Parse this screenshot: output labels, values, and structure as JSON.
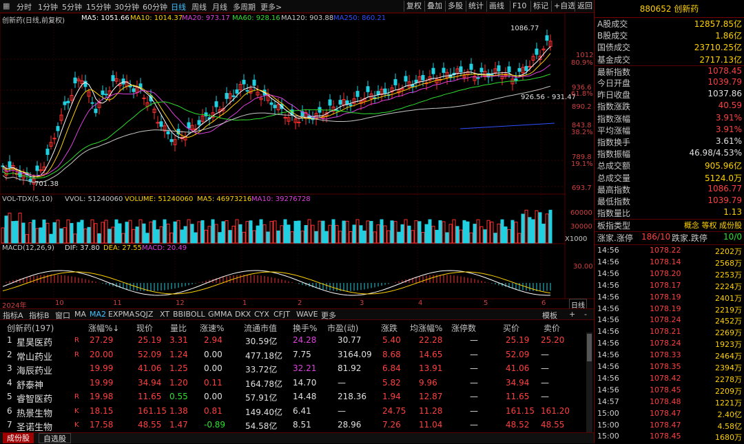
{
  "toolbar": {
    "periods": [
      "分时",
      "1分钟",
      "5分钟",
      "15分钟",
      "30分钟",
      "60分钟",
      "日线",
      "周线",
      "月线",
      "多周期",
      "更多>"
    ],
    "active_period": "日线",
    "right_buttons": [
      "复权",
      "叠加",
      "多股",
      "统计",
      "画线",
      "F10",
      "标记",
      "+自选",
      "返回"
    ]
  },
  "main": {
    "title": "创新药(日线,前复权)",
    "ma": [
      {
        "label": "MA5: 1051.66",
        "color": "#ffffff"
      },
      {
        "label": "MA10: 1014.37",
        "color": "#ffd200"
      },
      {
        "label": "MA20: 973.17",
        "color": "#e040e0"
      },
      {
        "label": "MA60: 928.16",
        "color": "#30e030"
      },
      {
        "label": "MA120: 903.88",
        "color": "#c8c8c8"
      },
      {
        "label": "MA250: 860.21",
        "color": "#3050ff"
      }
    ],
    "high_label": "1086.77",
    "low_label": "701.38",
    "mid_label": "926.56 - 931.47",
    "y_ticks": [
      {
        "price": "1012",
        "pct": "80.9%"
      },
      {
        "price": "936.6",
        "pct": "61.8%"
      },
      {
        "price": "890.2",
        "pct": ""
      },
      {
        "price": "843.8",
        "pct": "38.2%"
      },
      {
        "price": "789.8",
        "pct": "19.1%"
      },
      {
        "price": "693.7",
        "pct": ""
      }
    ]
  },
  "volume": {
    "title": "VOL-TDX(5,10)",
    "vol": "VVOL: 51240060",
    "volume": "VOLUME: 51240060",
    "ma5": "MA5: 46973216",
    "ma10": "MA10: 39276728",
    "y_ticks": [
      "60000",
      "30000"
    ],
    "unit": "X1000"
  },
  "macd": {
    "title": "MACD(12,26,9)",
    "dif": "DIF: 37.80",
    "dea": "DEA: 27.55",
    "macd": "MACD: 20.49",
    "y_tick": "30.00"
  },
  "x_axis": {
    "labels": [
      "2024年",
      "10",
      "11",
      "12",
      "1",
      "2",
      "3",
      "4",
      "5",
      "6"
    ],
    "period_box": "日线"
  },
  "tabs": [
    "指标A",
    "指标B",
    "窗口",
    "MA",
    "MA2",
    "EXPMA",
    "SQJZ",
    "XT",
    "BBIBOLL",
    "GMMA",
    "DKX",
    "CYX",
    "CFJT",
    "WAVE",
    "更多"
  ],
  "tabs_active": "MA2",
  "tabs_right": [
    "模板",
    "+",
    "-"
  ],
  "table": {
    "headers": [
      "创新药(197)",
      "涨幅%↓",
      "现价",
      "量比",
      "涨速%",
      "流通市值",
      "换手%",
      "市盈(动)",
      "涨跌",
      "均涨幅%",
      "涨停数",
      "买价",
      "卖价"
    ],
    "rows": [
      {
        "idx": "1",
        "name": "星昊医药",
        "flag": "R",
        "pct": "27.29",
        "price": "25.19",
        "lb": "3.31",
        "speed": "2.94",
        "cap": "30.59亿",
        "turn": "24.28",
        "pe": "30.77",
        "chg": "5.40",
        "avg": "22.28",
        "ztcount": "—",
        "buy": "25.19",
        "sell": "25.20"
      },
      {
        "idx": "2",
        "name": "常山药业",
        "flag": "R",
        "pct": "20.00",
        "price": "52.09",
        "lb": "1.24",
        "speed": "0.00",
        "cap": "477.18亿",
        "turn": "7.75",
        "pe": "3164.09",
        "chg": "8.68",
        "avg": "14.65",
        "ztcount": "—",
        "buy": "52.09",
        "sell": "—"
      },
      {
        "idx": "3",
        "name": "海辰药业",
        "flag": "",
        "pct": "19.99",
        "price": "41.06",
        "lb": "1.25",
        "speed": "0.00",
        "cap": "33.72亿",
        "turn": "32.21",
        "pe": "81.92",
        "chg": "6.84",
        "avg": "13.91",
        "ztcount": "—",
        "buy": "41.06",
        "sell": "—"
      },
      {
        "idx": "4",
        "name": "舒泰神",
        "flag": "",
        "pct": "19.99",
        "price": "34.94",
        "lb": "1.20",
        "speed": "0.11",
        "cap": "164.78亿",
        "turn": "14.70",
        "pe": "—",
        "chg": "5.82",
        "avg": "9.96",
        "ztcount": "—",
        "buy": "34.94",
        "sell": "—"
      },
      {
        "idx": "5",
        "name": "睿智医药",
        "flag": "R",
        "pct": "19.98",
        "price": "11.65",
        "lb": "0.55",
        "speed": "0.00",
        "cap": "57.91亿",
        "turn": "14.48",
        "pe": "218.36",
        "chg": "1.94",
        "avg": "12.87",
        "ztcount": "—",
        "buy": "11.65",
        "sell": "—"
      },
      {
        "idx": "6",
        "name": "热景生物",
        "flag": "K",
        "pct": "18.15",
        "price": "161.15",
        "lb": "1.38",
        "speed": "0.81",
        "cap": "149.40亿",
        "turn": "6.41",
        "pe": "—",
        "chg": "24.75",
        "avg": "11.28",
        "ztcount": "—",
        "buy": "161.15",
        "sell": "161.20"
      },
      {
        "idx": "7",
        "name": "圣诺生物",
        "flag": "K",
        "pct": "17.58",
        "price": "48.55",
        "lb": "1.47",
        "speed": "-0.89",
        "cap": "54.58亿",
        "turn": "8.51",
        "pe": "28.96",
        "chg": "7.26",
        "avg": "11.04",
        "ztcount": "—",
        "buy": "48.52",
        "sell": "48.55"
      }
    ]
  },
  "bottom_tabs": [
    "成份股",
    "自选股"
  ],
  "sidebar": {
    "header": "880652 创新药",
    "rows": [
      {
        "k": "A股成交",
        "v": "12857.85亿",
        "c": "#ffd200"
      },
      {
        "k": "B股成交",
        "v": "1.86亿",
        "c": "#ffd200"
      },
      {
        "k": "国债成交",
        "v": "23710.25亿",
        "c": "#ffd200"
      },
      {
        "k": "基金成交",
        "v": "2717.13亿",
        "c": "#ffd200"
      },
      {
        "k": "最新指数",
        "v": "1078.45",
        "c": "#ff4040"
      },
      {
        "k": "今日开盘",
        "v": "1039.79",
        "c": "#ff4040"
      },
      {
        "k": "昨日收盘",
        "v": "1037.86",
        "c": "#e0e0e0"
      },
      {
        "k": "指数涨跌",
        "v": "40.59",
        "c": "#ff4040"
      },
      {
        "k": "指数涨幅",
        "v": "3.91%",
        "c": "#ff4040"
      },
      {
        "k": "平均涨幅",
        "v": "3.91%",
        "c": "#ff4040"
      },
      {
        "k": "指数换手",
        "v": "3.61%",
        "c": "#e0e0e0"
      },
      {
        "k": "指数振幅",
        "v": "46.98/4.53%",
        "c": "#e0e0e0"
      },
      {
        "k": "总成交额",
        "v": "905.96亿",
        "c": "#ffd200"
      },
      {
        "k": "总成交量",
        "v": "5124.0万",
        "c": "#ffd200"
      },
      {
        "k": "最高指数",
        "v": "1086.77",
        "c": "#ff4040"
      },
      {
        "k": "最低指数",
        "v": "1039.79",
        "c": "#ff4040"
      },
      {
        "k": "指数量比",
        "v": "1.13",
        "c": "#ffd200"
      }
    ],
    "type_label": "板指类型",
    "type_value": "概念 等权 成份股",
    "updown_label": "涨家.涨停",
    "updown_value": "186/10",
    "fall_label": "跌家.跌停",
    "fall_value": "10/0",
    "ticks": [
      {
        "t": "14:56",
        "p": "1078.22",
        "v": "2202万"
      },
      {
        "t": "14:56",
        "p": "1078.14",
        "v": "2568万"
      },
      {
        "t": "14:56",
        "p": "1078.20",
        "v": "2253万"
      },
      {
        "t": "14:56",
        "p": "1078.17",
        "v": "2224万"
      },
      {
        "t": "14:56",
        "p": "1078.19",
        "v": "2401万"
      },
      {
        "t": "14:56",
        "p": "1078.19",
        "v": "2219万"
      },
      {
        "t": "14:56",
        "p": "1078.24",
        "v": "2452万"
      },
      {
        "t": "14:56",
        "p": "1078.21",
        "v": "2269万"
      },
      {
        "t": "14:56",
        "p": "1078.24",
        "v": "1923万"
      },
      {
        "t": "14:56",
        "p": "1078.33",
        "v": "2464万"
      },
      {
        "t": "14:56",
        "p": "1078.35",
        "v": "2394万"
      },
      {
        "t": "14:56",
        "p": "1078.42",
        "v": "2278万"
      },
      {
        "t": "14:56",
        "p": "1078.45",
        "v": "2209万"
      },
      {
        "t": "14:57",
        "p": "1078.48",
        "v": "1221万"
      },
      {
        "t": "15:00",
        "p": "1078.47",
        "v": "2.40亿"
      },
      {
        "t": "15:00",
        "p": "1078.47",
        "v": "4.58亿"
      },
      {
        "t": "15:00",
        "p": "1078.45",
        "v": "1680万"
      }
    ]
  }
}
